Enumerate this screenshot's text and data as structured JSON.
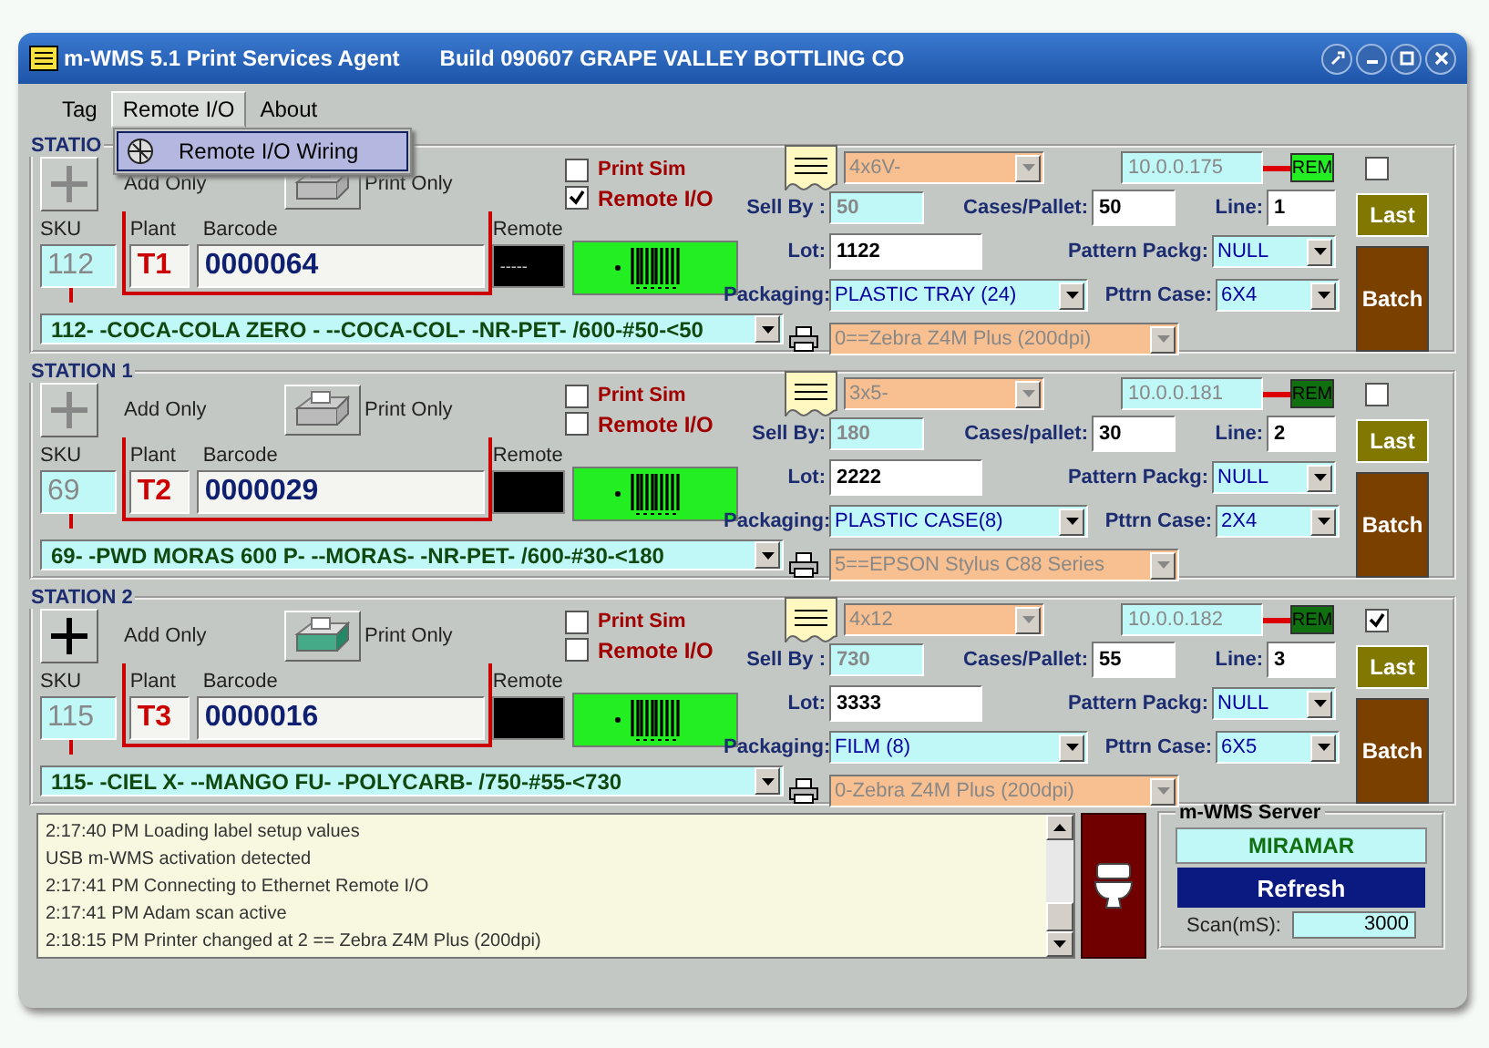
{
  "window": {
    "title": "m-WMS 5.1 Print Services Agent",
    "build": "Build 090607  GRAPE VALLEY BOTTLING CO"
  },
  "menu": [
    {
      "label": "Tag",
      "selected": false
    },
    {
      "label": "Remote I/O",
      "selected": true
    },
    {
      "label": "About",
      "selected": false
    }
  ],
  "popup_menu": [
    {
      "label": "Remote I/O Wiring",
      "selected": true
    }
  ],
  "stations": [
    {
      "title": "STATIO",
      "add_enabled": false,
      "add_label": "Add Only",
      "print_enabled": false,
      "print_label": "Print Only",
      "checks": [
        {
          "label": "Print Sim",
          "checked": false
        },
        {
          "label": "Remote I/O",
          "checked": true
        }
      ],
      "sku_label": "SKU",
      "plant_label": "Plant",
      "barcode_label": "Barcode",
      "remote_label": "Remote",
      "sku": "112",
      "plant": "T1",
      "barcode": "0000064",
      "remote": "-----",
      "product": "112- -COCA-COLA ZERO - --COCA-COL-  -NR-PET- /600-#50-<50",
      "label_size": "4x6V-",
      "ip": "10.0.0.175",
      "rem": "REM",
      "rem_on": true,
      "enabled": false,
      "sell_by_label": "Sell By :",
      "sell_by": "50",
      "cases_label": "Cases/Pallet:",
      "cases": "50",
      "line_label": "Line:",
      "line": "1",
      "lot_label": "Lot:",
      "lot": "1122",
      "pattern_label": "Pattern Packg:",
      "pattern": "NULL",
      "packaging_label": "Packaging:",
      "packaging": "PLASTIC TRAY (24)",
      "pttrn_label": "Pttrn Case:",
      "pttrn": "6X4",
      "printer": "0==Zebra  Z4M Plus (200dpi)",
      "last": "Last",
      "batch": "Batch"
    },
    {
      "title": "STATION 1",
      "add_enabled": false,
      "add_label": "Add Only",
      "print_enabled": false,
      "print_label": "Print Only",
      "checks": [
        {
          "label": "Print Sim",
          "checked": false
        },
        {
          "label": "Remote I/O",
          "checked": false
        }
      ],
      "sku_label": "SKU",
      "plant_label": "Plant",
      "barcode_label": "Barcode",
      "remote_label": "Remote",
      "sku": "69",
      "plant": "T2",
      "barcode": "0000029",
      "product": "69- -PWD MORAS 600 P- --MORAS-  -NR-PET- /600-#30-<180",
      "label_size": "3x5-",
      "ip": "10.0.0.181",
      "rem": "REM",
      "rem_on": false,
      "enabled": false,
      "sell_by_label": "Sell By:",
      "sell_by": "180",
      "cases_label": "Cases/pallet:",
      "cases": "30",
      "line_label": "Line:",
      "line": "2",
      "lot_label": "Lot:",
      "lot": "2222",
      "pattern_label": "Pattern Packg:",
      "pattern": "NULL",
      "packaging_label": "Packaging:",
      "packaging": "PLASTIC CASE(8)",
      "pttrn_label": "Pttrn Case:",
      "pttrn": "2X4",
      "printer": "5==EPSON Stylus C88 Series",
      "last": "Last",
      "batch": "Batch"
    },
    {
      "title": "STATION 2",
      "add_enabled": true,
      "add_label": "Add Only",
      "print_enabled": true,
      "print_label": "Print Only",
      "checks": [
        {
          "label": "Print Sim",
          "checked": false
        },
        {
          "label": "Remote I/O",
          "checked": false
        }
      ],
      "sku_label": "SKU",
      "plant_label": "Plant",
      "barcode_label": "Barcode",
      "remote_label": "Remote",
      "sku": "115",
      "plant": "T3",
      "barcode": "0000016",
      "product": "115- -CIEL X- --MANGO FU-  -POLYCARB- /750-#55-<730",
      "label_size": "4x12",
      "ip": "10.0.0.182",
      "rem": "REM",
      "rem_on": false,
      "enabled": true,
      "sell_by_label": "Sell By :",
      "sell_by": "730",
      "cases_label": "Cases/Pallet:",
      "cases": "55",
      "line_label": "Line:",
      "line": "3",
      "lot_label": "Lot:",
      "lot": "3333",
      "pattern_label": "Pattern Packg:",
      "pattern": "NULL",
      "packaging_label": "Packaging:",
      "packaging": "FILM (8)",
      "pttrn_label": "Pttrn Case:",
      "pttrn": "6X5",
      "printer": "0-Zebra  Z4M Plus (200dpi)",
      "last": "Last",
      "batch": "Batch"
    }
  ],
  "log": [
    "2:17:40 PM Loading label setup values",
    "USB m-WMS activation detected",
    "2:17:41 PM Connecting to Ethernet Remote I/O",
    "2:17:41 PM Adam scan active",
    "2:18:15 PM Printer changed at 2 == Zebra  Z4M Plus (200dpi)"
  ],
  "server": {
    "title": "m-WMS Server",
    "name": "MIRAMAR",
    "refresh": "Refresh",
    "scan_label": "Scan(mS):",
    "scan": "3000"
  }
}
